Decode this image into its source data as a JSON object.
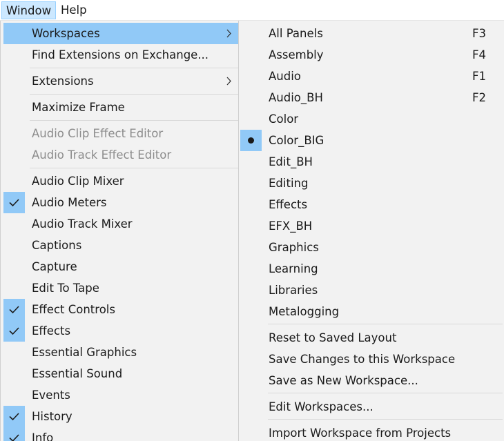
{
  "menubar": {
    "items": [
      {
        "label": "Window"
      },
      {
        "label": "Help"
      }
    ]
  },
  "window_menu": {
    "items": [
      {
        "label": "Workspaces"
      },
      {
        "label": "Find Extensions on Exchange..."
      },
      {
        "label": "Extensions"
      },
      {
        "label": "Maximize Frame"
      },
      {
        "label": "Audio Clip Effect Editor"
      },
      {
        "label": "Audio Track Effect Editor"
      },
      {
        "label": "Audio Clip Mixer"
      },
      {
        "label": "Audio Meters"
      },
      {
        "label": "Audio Track Mixer"
      },
      {
        "label": "Captions"
      },
      {
        "label": "Capture"
      },
      {
        "label": "Edit To Tape"
      },
      {
        "label": "Effect Controls"
      },
      {
        "label": "Effects"
      },
      {
        "label": "Essential Graphics"
      },
      {
        "label": "Essential Sound"
      },
      {
        "label": "Events"
      },
      {
        "label": "History"
      },
      {
        "label": "Info"
      }
    ]
  },
  "workspaces_menu": {
    "items": [
      {
        "label": "All Panels",
        "shortcut": "F3"
      },
      {
        "label": "Assembly",
        "shortcut": "F4"
      },
      {
        "label": "Audio",
        "shortcut": "F1"
      },
      {
        "label": "Audio_BH",
        "shortcut": "F2"
      },
      {
        "label": "Color"
      },
      {
        "label": "Color_BIG"
      },
      {
        "label": "Edit_BH"
      },
      {
        "label": "Editing"
      },
      {
        "label": "Effects"
      },
      {
        "label": "EFX_BH"
      },
      {
        "label": "Graphics"
      },
      {
        "label": "Learning"
      },
      {
        "label": "Libraries"
      },
      {
        "label": "Metalogging"
      },
      {
        "label": "Reset to Saved Layout"
      },
      {
        "label": "Save Changes to this Workspace"
      },
      {
        "label": "Save as New Workspace..."
      },
      {
        "label": "Edit Workspaces..."
      },
      {
        "label": "Import Workspace from Projects"
      }
    ]
  },
  "colors": {
    "highlight": "#91c9f7",
    "menubar_active": "#cce8ff",
    "disabled_text": "#8c8c8c"
  }
}
